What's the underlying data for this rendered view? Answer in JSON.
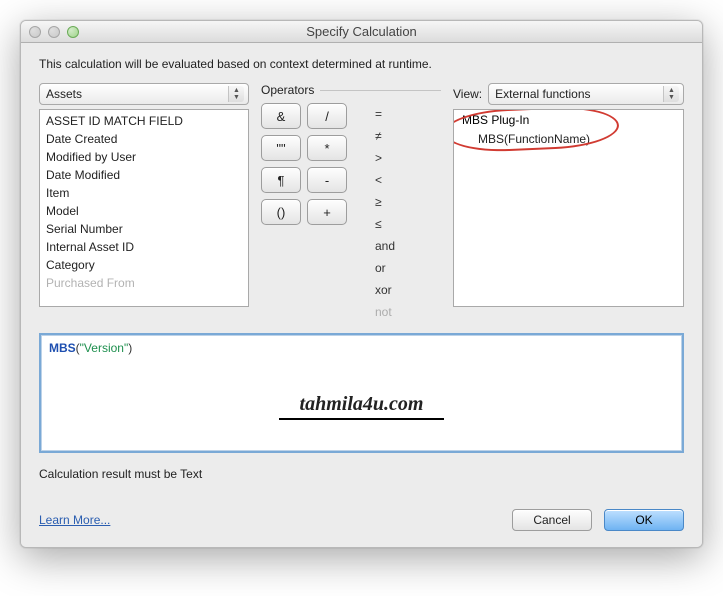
{
  "window": {
    "title": "Specify Calculation"
  },
  "intro": "This calculation will be evaluated based on context determined at runtime.",
  "left": {
    "table_select": "Assets",
    "fields": [
      "ASSET ID MATCH FIELD",
      "Date Created",
      "Modified by User",
      "Date Modified",
      "Item",
      "Model",
      "Serial Number",
      "Internal Asset ID",
      "Category",
      "Purchased From"
    ]
  },
  "operators": {
    "label": "Operators",
    "buttons": [
      "&",
      "/",
      "\"\"",
      "*",
      "¶",
      "-",
      "()",
      "+"
    ],
    "symbols": [
      "=",
      "≠",
      ">",
      "<",
      "≥",
      "≤",
      "and",
      "or",
      "xor",
      "not"
    ]
  },
  "view": {
    "label": "View:",
    "select": "External functions",
    "group": "MBS Plug-In",
    "item": "MBS(FunctionName)"
  },
  "calc": {
    "func": "MBS",
    "open": "(",
    "arg": "\"Version\"",
    "close": ")"
  },
  "watermark": "tahmila4u.com",
  "result_text": "Calculation result must be Text",
  "footer": {
    "learn": "Learn More...",
    "cancel": "Cancel",
    "ok": "OK"
  }
}
